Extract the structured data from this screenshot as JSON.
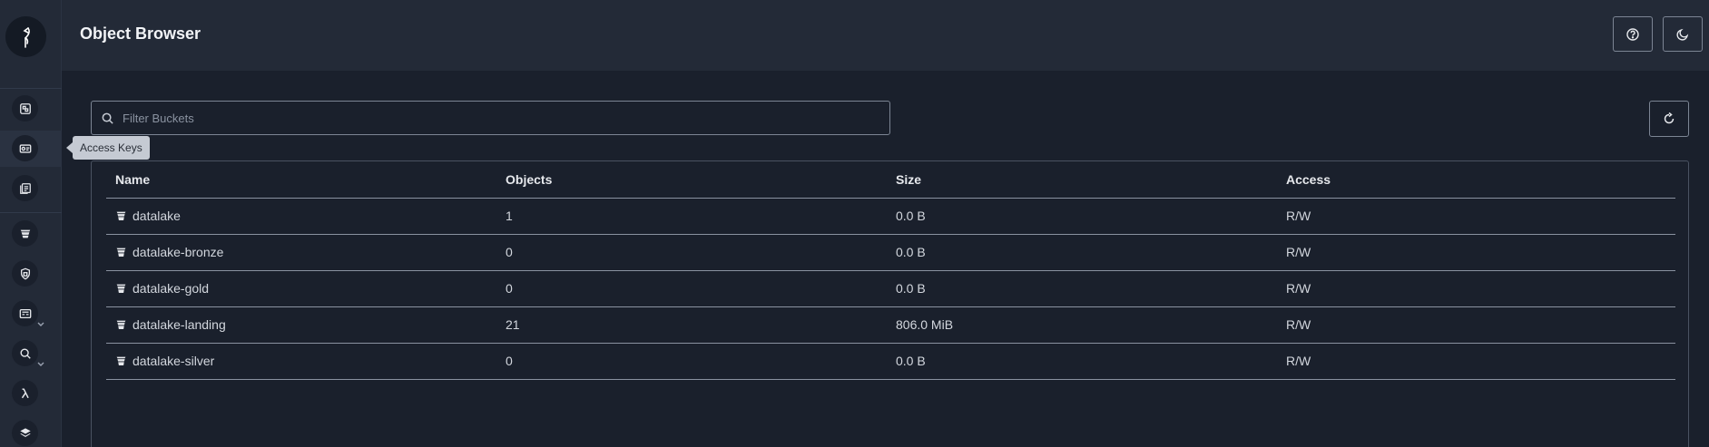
{
  "header": {
    "title": "Object Browser",
    "help_icon": "help-circle-icon",
    "theme_icon": "moon-icon"
  },
  "sidebar": {
    "logo_icon": "heron-logo-icon",
    "items": [
      {
        "icon": "dashboard-icon"
      },
      {
        "icon": "access-keys-icon"
      },
      {
        "icon": "documentation-icon"
      },
      {
        "icon": "buckets-icon"
      },
      {
        "icon": "policies-icon"
      },
      {
        "icon": "identity-icon"
      },
      {
        "icon": "monitoring-icon"
      },
      {
        "icon": "lambda-icon"
      },
      {
        "icon": "tiers-icon"
      }
    ],
    "tooltip": "Access Keys"
  },
  "search": {
    "placeholder": "Filter Buckets",
    "value": ""
  },
  "table": {
    "columns": [
      "Name",
      "Objects",
      "Size",
      "Access"
    ],
    "rows": [
      {
        "name": "datalake",
        "objects": "1",
        "size": "0.0 B",
        "access": "R/W"
      },
      {
        "name": "datalake-bronze",
        "objects": "0",
        "size": "0.0 B",
        "access": "R/W"
      },
      {
        "name": "datalake-gold",
        "objects": "0",
        "size": "0.0 B",
        "access": "R/W"
      },
      {
        "name": "datalake-landing",
        "objects": "21",
        "size": "806.0 MiB",
        "access": "R/W"
      },
      {
        "name": "datalake-silver",
        "objects": "0",
        "size": "0.0 B",
        "access": "R/W"
      }
    ]
  },
  "colors": {
    "background": "#1a202c",
    "panel": "#232a37",
    "border": "#7c8594",
    "text": "#e6e8ec"
  }
}
